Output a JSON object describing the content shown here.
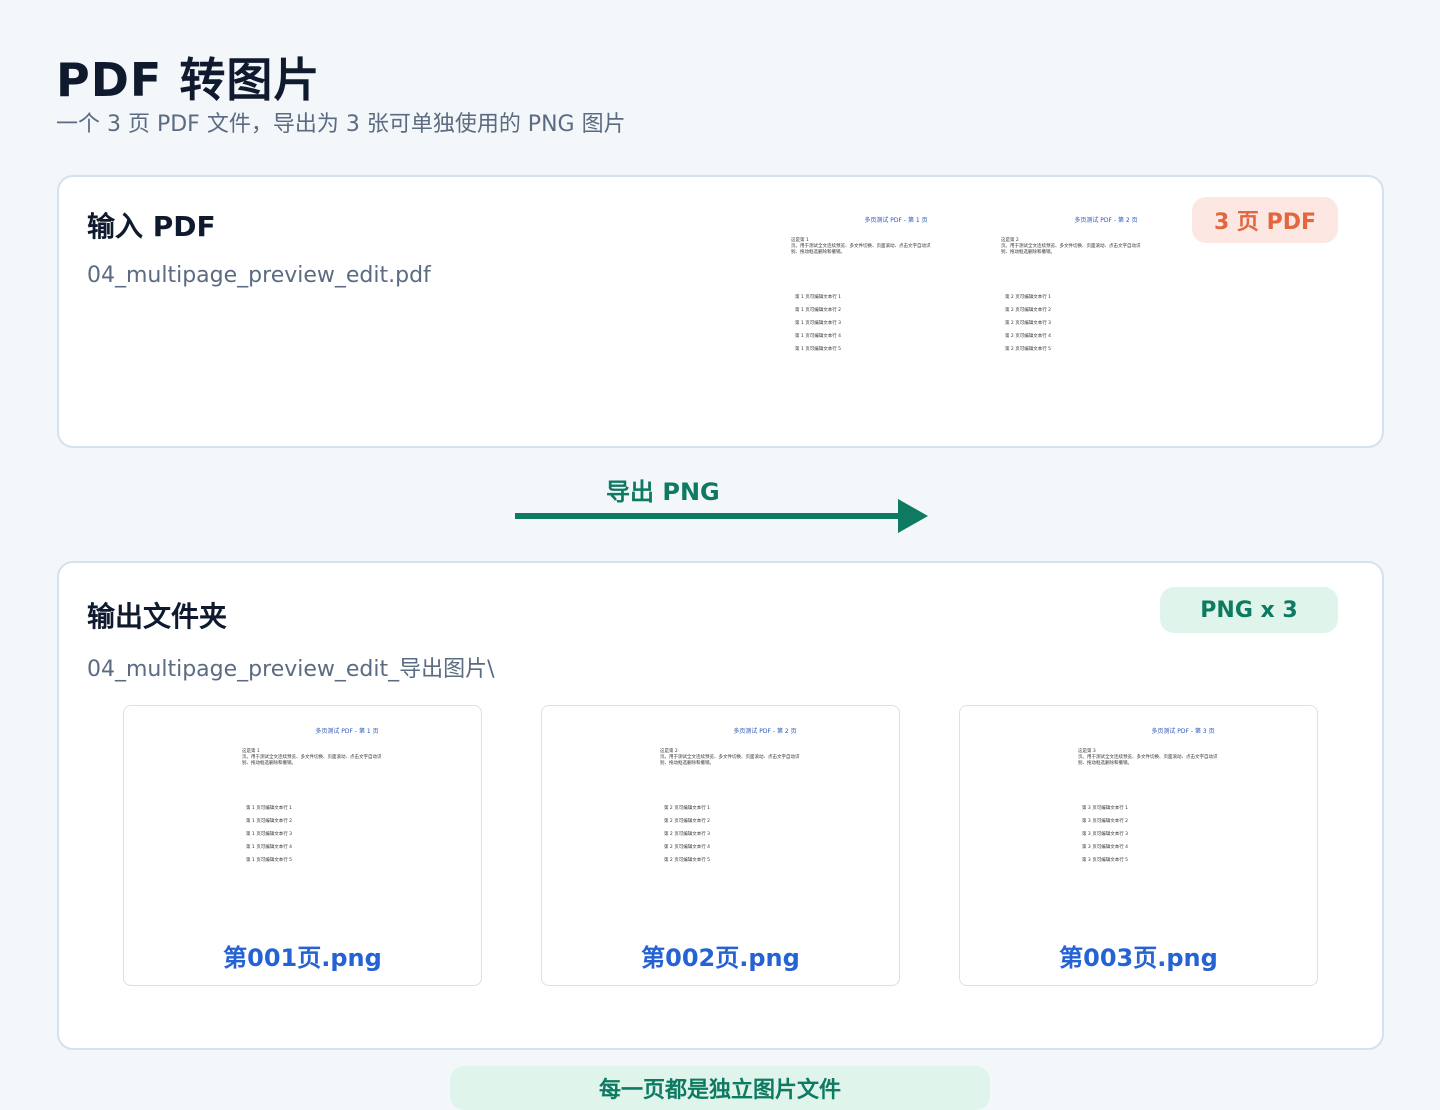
{
  "header": {
    "title": "PDF 转图片",
    "subtitle": "一个 3 页 PDF 文件，导出为 3 张可单独使用的 PNG 图片"
  },
  "input": {
    "title": "输入 PDF",
    "filename": "04_multipage_preview_edit.pdf",
    "badge": "3 页 PDF",
    "pages": [
      {
        "title": "多页测试 PDF - 第 1 页",
        "body1": "这是第 1",
        "body2": "页。用于测试全文连续预览、多文件切换、页面滚动、点击文字自动识",
        "body3": "别、拖动框选删除和撤销。",
        "lines": [
          "第 1 页可编辑文本行 1",
          "第 1 页可编辑文本行 2",
          "第 1 页可编辑文本行 3",
          "第 1 页可编辑文本行 4",
          "第 1 页可编辑文本行 5"
        ]
      },
      {
        "title": "多页测试 PDF - 第 2 页",
        "body1": "这是第 2",
        "body2": "页。用于测试全文连续预览、多文件切换、页面滚动、点击文字自动识",
        "body3": "别、拖动框选删除和撤销。",
        "lines": [
          "第 2 页可编辑文本行 1",
          "第 2 页可编辑文本行 2",
          "第 2 页可编辑文本行 3",
          "第 2 页可编辑文本行 4",
          "第 2 页可编辑文本行 5"
        ]
      }
    ]
  },
  "arrow": {
    "label": "导出 PNG"
  },
  "output": {
    "title": "输出文件夹",
    "folder": "04_multipage_preview_edit_导出图片\\",
    "badge": "PNG x 3",
    "images": [
      {
        "filename": "第001页.png",
        "title": "多页测试 PDF - 第 1 页",
        "body1": "这是第 1",
        "body2": "页。用于测试全文连续预览、多文件切换、页面滚动、点击文字自动识",
        "body3": "别、拖动框选删除和撤销。",
        "lines": [
          "第 1 页可编辑文本行 1",
          "第 1 页可编辑文本行 2",
          "第 1 页可编辑文本行 3",
          "第 1 页可编辑文本行 4",
          "第 1 页可编辑文本行 5"
        ]
      },
      {
        "filename": "第002页.png",
        "title": "多页测试 PDF - 第 2 页",
        "body1": "这是第 2",
        "body2": "页。用于测试全文连续预览、多文件切换、页面滚动、点击文字自动识",
        "body3": "别、拖动框选删除和撤销。",
        "lines": [
          "第 2 页可编辑文本行 1",
          "第 2 页可编辑文本行 2",
          "第 2 页可编辑文本行 3",
          "第 2 页可编辑文本行 4",
          "第 2 页可编辑文本行 5"
        ]
      },
      {
        "filename": "第003页.png",
        "title": "多页测试 PDF - 第 3 页",
        "body1": "这是第 3",
        "body2": "页。用于测试全文连续预览、多文件切换、页面滚动、点击文字自动识",
        "body3": "别、拖动框选删除和撤销。",
        "lines": [
          "第 3 页可编辑文本行 1",
          "第 3 页可编辑文本行 2",
          "第 3 页可编辑文本行 3",
          "第 3 页可编辑文本行 4",
          "第 3 页可编辑文本行 5"
        ]
      }
    ]
  },
  "footer": {
    "note": "每一页都是独立图片文件"
  },
  "colors": {
    "accent_green": "#0f7a62",
    "accent_orange": "#e2673f",
    "accent_blue": "#2563d4"
  }
}
